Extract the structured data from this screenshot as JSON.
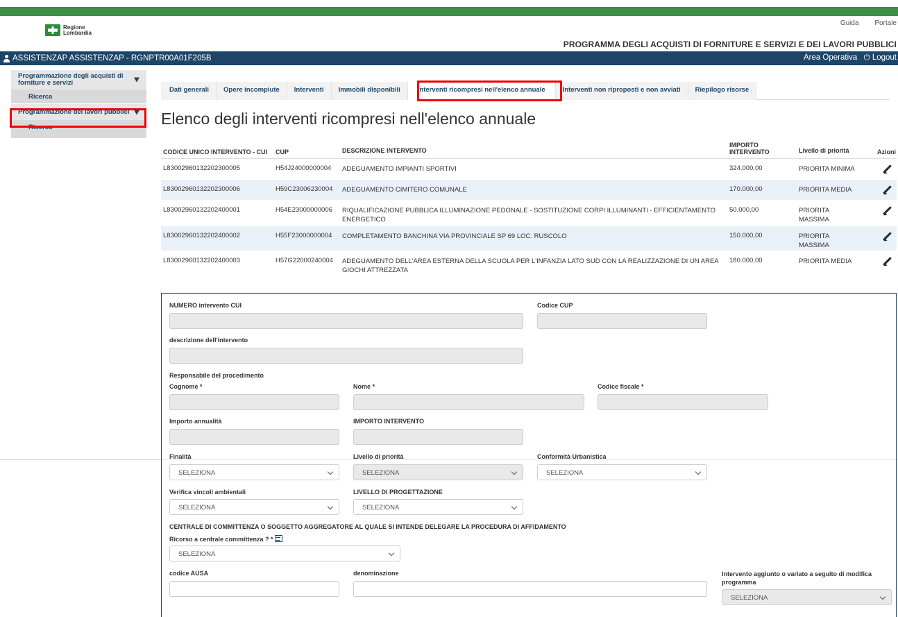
{
  "header": {
    "links": [
      "Guida",
      "Portale"
    ],
    "logo_line1": "Regione",
    "logo_line2": "Lombardia",
    "program_title": "PROGRAMMA DEGLI ACQUISTI DI FORNITURE E SERVIZI E DEI LAVORI PUBBLICI"
  },
  "userbar": {
    "user": "ASSISTENZAP ASSISTENZAP - RGNPTR00A01F205B",
    "area": "Area Operativa",
    "logout": "Logout"
  },
  "sidebar": {
    "groups": [
      {
        "title": "Programmazione degli acquisti di forniture e servizi",
        "sub": "Ricerca"
      },
      {
        "title": "Programmazione dei lavori pubblici",
        "sub": "Ricerca"
      }
    ]
  },
  "tabs": [
    "Dati generali",
    "Opere incompiute",
    "Interventi",
    "Immobili disponibili",
    "Interventi ricompresi nell'elenco annuale",
    "Interventi non riproposti e non avviati",
    "Riepilogo risorse"
  ],
  "active_tab_index": 4,
  "page_title": "Elenco degli interventi ricompresi nell'elenco annuale",
  "table": {
    "headers": [
      "CODICE UNICO INTERVENTO - CUI",
      "CUP",
      "DESCRIZIONE INTERVENTO",
      "IMPORTO INTERVENTO",
      "Livello di priorità",
      "Azioni"
    ],
    "rows": [
      {
        "cui": "L83002960132202300005",
        "cup": "H54J24000000004",
        "desc": "ADEGUAMENTO IMPIANTI SPORTIVI",
        "importo": "324.000,00",
        "priorita": "PRIORITA MINIMA"
      },
      {
        "cui": "L83002960132202300006",
        "cup": "H59C23006230004",
        "desc": "ADEGUAMENTO CIMITERO COMUNALE",
        "importo": "170.000,00",
        "priorita": "PRIORITA MEDIA"
      },
      {
        "cui": "L83002960132202400001",
        "cup": "H54E23000000006",
        "desc": "RIQUALIFICAZIONE PUBBLICA ILLUMINAZIONE PEDONALE - SOSTITUZIONE CORPI ILLUMINANTI - EFFICIENTAMENTO ENERGETICO",
        "importo": "50.000,00",
        "priorita": "PRIORITA MASSIMA"
      },
      {
        "cui": "L83002960132202400002",
        "cup": "H55F23000000004",
        "desc": "COMPLETAMENTO BANCHINA VIA PROVINCIALE SP 69 LOC. RUSCOLO",
        "importo": "150.000,00",
        "priorita": "PRIORITA MASSIMA"
      },
      {
        "cui": "L83002960132202400003",
        "cup": "H57G22000240004",
        "desc": "ADEGUAMENTO DELL'AREA ESTERNA DELLA SCUOLA PER L'INFANZIA LATO SUD CON LA REALIZZAZIONE DI UN AREA GIOCHI ATTREZZATA",
        "importo": "180.000,00",
        "priorita": "PRIORITA MEDIA"
      }
    ]
  },
  "form": {
    "numero_cui": "NUMERO intervento CUI",
    "codice_cup": "Codice CUP",
    "descrizione": "descrizione dell'intervento",
    "responsabile": "Responsabile del procedimento",
    "cognome": "Cognome *",
    "nome": "Nome *",
    "codice_fiscale": "Codice fiscale *",
    "importo_annualita": "Importo annualità",
    "importo_intervento": "IMPORTO INTERVENTO",
    "finalita": "Finalità",
    "livello_priorita": "Livello di priorità",
    "conformita": "Conformità Urbanistica",
    "verifica_vincoli": "Verifica vincoli ambientali",
    "livello_progettazione": "LIVELLO DI PROGETTAZIONE",
    "centrale_title": "CENTRALE DI COMMITTENZA O SOGGETTO AGGREGATORE AL QUALE SI INTENDE DELEGARE LA PROCEDURA DI AFFIDAMENTO",
    "ricorso": "Ricorso a centrale committenza ? *",
    "codice_ausa": "codice AUSA",
    "denominazione": "denominazione",
    "intervento_aggiunto": "Intervento aggiunto o variato a seguito di modifica programma",
    "select_placeholder": "SELEZIONA"
  }
}
